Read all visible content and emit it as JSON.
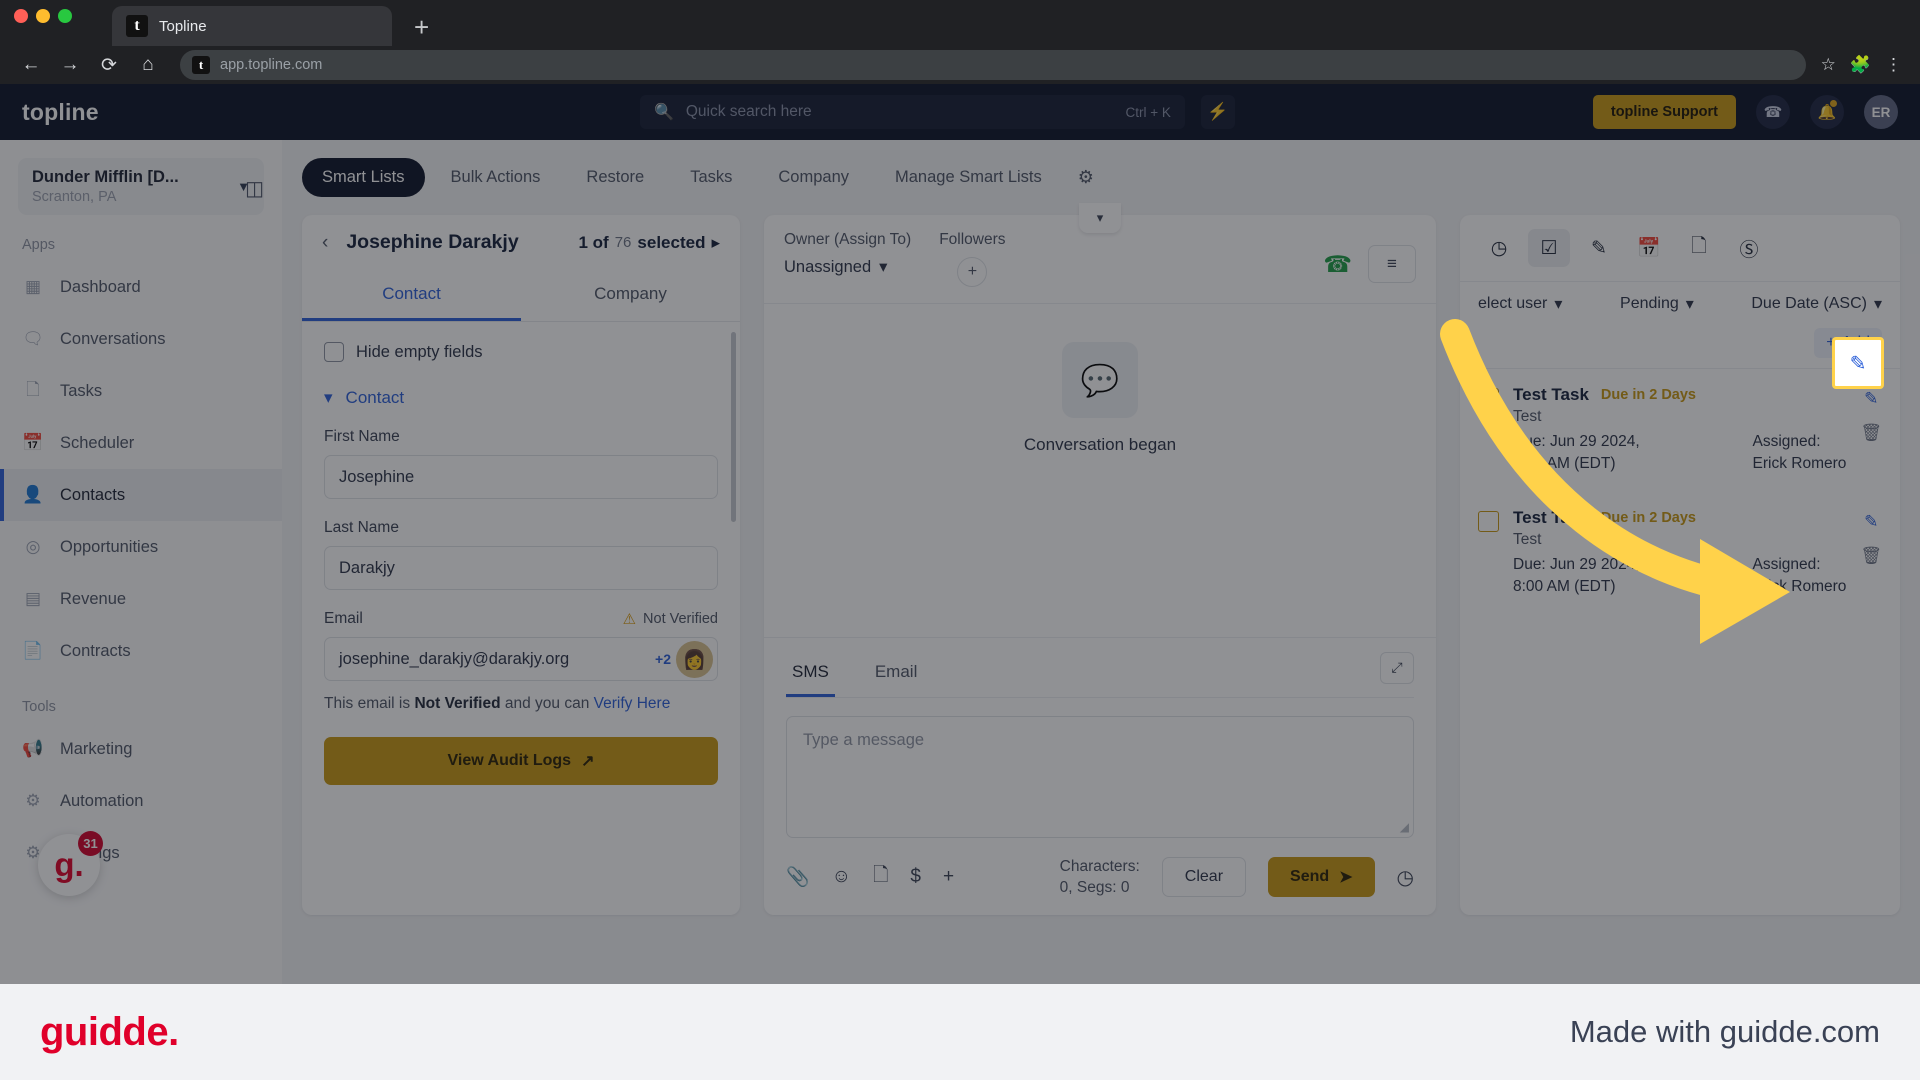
{
  "browser": {
    "tab_title": "Topline",
    "favicon_letter": "t",
    "new_tab_label": "+",
    "back_icon": "back-arrow-icon",
    "forward_icon": "forward-arrow-icon",
    "reload_icon": "reload-icon",
    "home_icon": "home-icon",
    "url": "app.topline.com",
    "star_icon": "bookmark-star-icon",
    "extensions_icon": "extensions-puzzle-icon",
    "menu_icon": "three-dot-menu-icon"
  },
  "topbar": {
    "brand": "topline",
    "search_placeholder": "Quick search here",
    "search_shortcut": "Ctrl + K",
    "bolt_icon": "lightning-bolt-icon",
    "support_button": "topline Support",
    "phone_icon": "phone-icon",
    "bell_icon": "notification-bell-icon",
    "avatar_initials": "ER"
  },
  "sidebar": {
    "org_name": "Dunder Mifflin [D...",
    "org_location": "Scranton, PA",
    "collapse_icon": "panel-collapse-icon",
    "apps_label": "Apps",
    "tools_label": "Tools",
    "apps": [
      {
        "label": "Dashboard",
        "icon": "dashboard-icon"
      },
      {
        "label": "Conversations",
        "icon": "chat-bubbles-icon"
      },
      {
        "label": "Tasks",
        "icon": "task-document-icon"
      },
      {
        "label": "Scheduler",
        "icon": "calendar-icon"
      },
      {
        "label": "Contacts",
        "icon": "person-icon"
      },
      {
        "label": "Opportunities",
        "icon": "target-icon"
      },
      {
        "label": "Revenue",
        "icon": "credit-card-icon"
      },
      {
        "label": "Contracts",
        "icon": "contract-document-icon"
      }
    ],
    "tools": [
      {
        "label": "Marketing",
        "icon": "megaphone-icon"
      },
      {
        "label": "Automation",
        "icon": "gears-icon"
      }
    ],
    "settings_label": "Settings",
    "guidde_badge_letter": "g.",
    "guidde_badge_count": "31"
  },
  "nav_tabs": [
    {
      "label": "Smart Lists",
      "active": true
    },
    {
      "label": "Bulk Actions",
      "active": false
    },
    {
      "label": "Restore",
      "active": false
    },
    {
      "label": "Tasks",
      "active": false
    },
    {
      "label": "Company",
      "active": false
    },
    {
      "label": "Manage Smart Lists",
      "active": false
    }
  ],
  "nav_gear_icon": "settings-gear-icon",
  "contact_panel": {
    "back_icon": "chevron-left-icon",
    "contact_name": "Josephine Darakjy",
    "selection_prefix": "1 of",
    "selection_count": "76",
    "selection_suffix": "selected",
    "next_icon": "chevron-right-icon",
    "tabs": [
      {
        "label": "Contact",
        "active": true
      },
      {
        "label": "Company",
        "active": false
      }
    ],
    "hide_empty_label": "Hide empty fields",
    "group_label": "Contact",
    "fields": [
      {
        "label": "First Name",
        "value": "Josephine"
      },
      {
        "label": "Last Name",
        "value": "Darakjy"
      }
    ],
    "email_label": "Email",
    "email_status": "Not Verified",
    "email_value": "josephine_darakjy@darakjy.org",
    "email_extra": "+2",
    "avatar_emoji": "👩",
    "hint_prefix": "This email is ",
    "hint_bold": "Not Verified",
    "hint_mid": " and you can ",
    "hint_link": "Verify Here",
    "audit_button": "View Audit Logs",
    "audit_icon": "external-link-icon"
  },
  "conversation": {
    "owner_label": "Owner (Assign To)",
    "owner_value": "Unassigned",
    "followers_label": "Followers",
    "add_follower_icon": "plus-icon",
    "call_icon": "phone-call-icon",
    "filter_icon": "filter-icon",
    "collapse_icon": "chevron-down-icon",
    "bubble_icon": "message-bubble-icon",
    "began_text": "Conversation began",
    "composer": {
      "tabs": [
        {
          "label": "SMS",
          "active": true
        },
        {
          "label": "Email",
          "active": false
        }
      ],
      "expand_icon": "collapse-diagonal-icon",
      "message_placeholder": "Type a message",
      "tools": [
        {
          "icon": "attachment-paperclip-icon"
        },
        {
          "icon": "emoji-smiley-icon"
        },
        {
          "icon": "template-document-icon"
        },
        {
          "icon": "dollar-payment-icon"
        },
        {
          "icon": "plus-icon"
        }
      ],
      "characters_line1": "Characters:",
      "characters_line2": "0, Segs: 0",
      "clear_button": "Clear",
      "send_button": "Send",
      "send_icon": "send-paper-plane-icon",
      "schedule_icon": "clock-icon"
    }
  },
  "tasks_panel": {
    "icons": [
      {
        "icon": "activity-clock-icon",
        "selected": false
      },
      {
        "icon": "task-check-icon",
        "selected": true
      },
      {
        "icon": "note-pen-icon",
        "selected": false
      },
      {
        "icon": "calendar-icon",
        "selected": false
      },
      {
        "icon": "document-icon",
        "selected": false
      },
      {
        "icon": "dollar-circle-icon",
        "selected": false
      }
    ],
    "filters": [
      {
        "label": "elect user",
        "icon": "chevron-down-icon"
      },
      {
        "label": "Pending",
        "icon": "chevron-down-icon"
      },
      {
        "label": "Due Date (ASC)",
        "icon": "chevron-down-icon"
      }
    ],
    "add_button": "Add",
    "add_icon": "plus-icon",
    "items": [
      {
        "title": "Test Task",
        "badge": "Due in 2 Days",
        "note": "Test",
        "due_line1": "Due: Jun 29 2024,",
        "due_line2": "8:00 AM (EDT)",
        "assigned_label": "Assigned:",
        "assigned_to": "Erick Romero",
        "edit_icon": "edit-pencil-square-icon",
        "delete_icon": "trash-icon"
      },
      {
        "title": "Test Task",
        "badge": "Due in 2 Days",
        "note": "Test",
        "due_line1": "Due: Jun 29 2024,",
        "due_line2": "8:00 AM (EDT)",
        "assigned_label": "Assigned:",
        "assigned_to": "Erick Romero",
        "edit_icon": "edit-pencil-square-icon",
        "delete_icon": "trash-icon"
      }
    ],
    "highlight_icon": "edit-pencil-square-icon"
  },
  "footer": {
    "logo": "guidde.",
    "made_with": "Made with guidde.com"
  },
  "colors": {
    "accent_gold": "#c79712",
    "accent_blue": "#2b5fd9",
    "dark_navy": "#0b1228",
    "arrow_yellow": "#ffd24a",
    "guidde_red": "#e0002a"
  }
}
